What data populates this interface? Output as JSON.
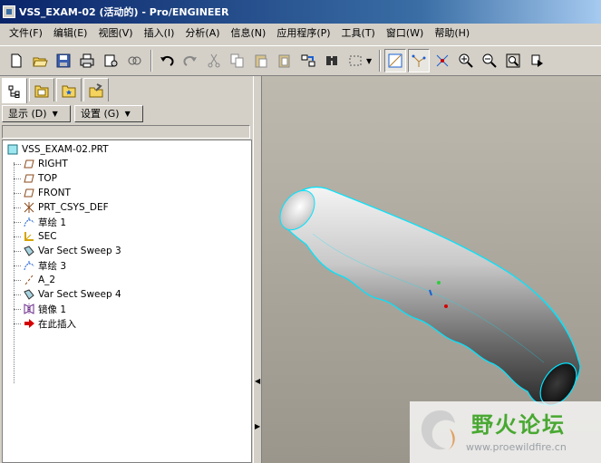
{
  "window": {
    "title": "VSS_EXAM-02 (活动的) - Pro/ENGINEER"
  },
  "menu": [
    "文件(F)",
    "编辑(E)",
    "视图(V)",
    "插入(I)",
    "分析(A)",
    "信息(N)",
    "应用程序(P)",
    "工具(T)",
    "窗口(W)",
    "帮助(H)"
  ],
  "toolbar": {
    "icons": [
      "new-icon",
      "open-icon",
      "save-icon",
      "print-icon",
      "send-mail-icon",
      "mapkey-icon",
      "undo-icon",
      "redo-icon",
      "cut-icon",
      "copy-icon",
      "paste-icon",
      "paste-special-icon",
      "regenerate-icon",
      "find-icon",
      "select-box-icon",
      "datum-planes-icon",
      "datum-axes-icon",
      "datum-points-icon",
      "zoom-in-icon",
      "zoom-out-icon",
      "refit-icon",
      "repaint-icon"
    ]
  },
  "navigator": {
    "tabs": [
      "model-tree-tab-icon",
      "folder-browser-tab-icon",
      "favorites-tab-icon",
      "connections-tab-icon"
    ],
    "show_label": "显示 (D)",
    "settings_label": "设置 (G)"
  },
  "tree": {
    "root": "VSS_EXAM-02.PRT",
    "items": [
      {
        "label": "RIGHT",
        "icon": "datum-plane-icon"
      },
      {
        "label": "TOP",
        "icon": "datum-plane-icon"
      },
      {
        "label": "FRONT",
        "icon": "datum-plane-icon"
      },
      {
        "label": "PRT_CSYS_DEF",
        "icon": "csys-icon"
      },
      {
        "label": "草绘 1",
        "icon": "sketch-icon"
      },
      {
        "label": "SEC",
        "icon": "coordinate-icon"
      },
      {
        "label": "Var Sect Sweep 3",
        "icon": "sweep-icon"
      },
      {
        "label": "草绘 3",
        "icon": "sketch-icon"
      },
      {
        "label": "A_2",
        "icon": "axis-icon"
      },
      {
        "label": "Var Sect Sweep 4",
        "icon": "sweep-icon"
      },
      {
        "label": "镜像 1",
        "icon": "mirror-icon"
      },
      {
        "label": "在此插入",
        "icon": "insert-here-arrow-icon"
      }
    ]
  },
  "watermark": {
    "title": "野火论坛",
    "url": "www.proewildfire.cn"
  },
  "colors": {
    "title_bar": "#0a246a",
    "model_edge": "#00e5ff",
    "watermark_green": "#49a832"
  }
}
